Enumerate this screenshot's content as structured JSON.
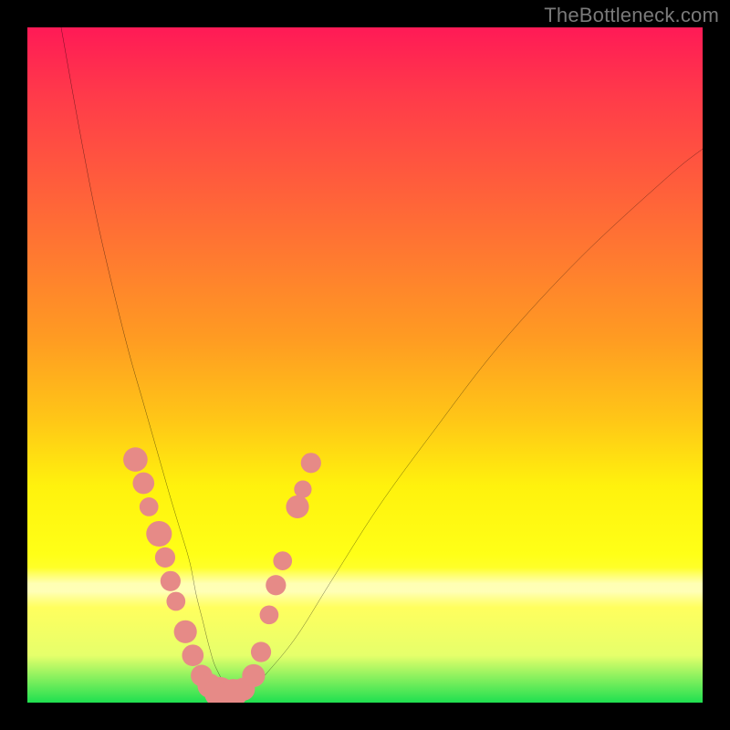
{
  "watermark": "TheBottleneck.com",
  "chart_data": {
    "type": "line",
    "title": "",
    "xlabel": "",
    "ylabel": "",
    "x_range": [
      0,
      100
    ],
    "y_range": [
      0,
      100
    ],
    "note": "No numeric axis ticks are visible; values are estimated in 0–100 plot-area percent coordinates (y = 0 at top, 100 at bottom).",
    "series": [
      {
        "name": "curve",
        "x": [
          5,
          7.5,
          10,
          12.5,
          15,
          17,
          19,
          21,
          22.5,
          24,
          25,
          26,
          27,
          28,
          30,
          33,
          36,
          40,
          45,
          52,
          60,
          70,
          82,
          95,
          100
        ],
        "y": [
          0,
          14,
          27,
          38,
          48,
          55,
          62,
          69,
          74,
          79,
          84,
          88,
          92,
          95,
          98,
          98,
          95,
          90,
          82,
          71,
          60,
          47,
          34,
          22,
          18
        ]
      }
    ],
    "markers": [
      {
        "x": 16.0,
        "y": 64.0,
        "r": 1.8
      },
      {
        "x": 17.2,
        "y": 67.5,
        "r": 1.6
      },
      {
        "x": 18.0,
        "y": 71.0,
        "r": 1.4
      },
      {
        "x": 19.5,
        "y": 75.0,
        "r": 1.9
      },
      {
        "x": 20.4,
        "y": 78.5,
        "r": 1.5
      },
      {
        "x": 21.2,
        "y": 82.0,
        "r": 1.5
      },
      {
        "x": 22.0,
        "y": 85.0,
        "r": 1.4
      },
      {
        "x": 23.4,
        "y": 89.5,
        "r": 1.7
      },
      {
        "x": 24.5,
        "y": 93.0,
        "r": 1.6
      },
      {
        "x": 25.8,
        "y": 96.0,
        "r": 1.6
      },
      {
        "x": 27.0,
        "y": 97.5,
        "r": 1.8
      },
      {
        "x": 28.5,
        "y": 98.5,
        "r": 2.3
      },
      {
        "x": 30.5,
        "y": 98.6,
        "r": 2.1
      },
      {
        "x": 32.0,
        "y": 98.0,
        "r": 1.7
      },
      {
        "x": 33.5,
        "y": 96.0,
        "r": 1.7
      },
      {
        "x": 34.6,
        "y": 92.5,
        "r": 1.5
      },
      {
        "x": 35.8,
        "y": 87.0,
        "r": 1.4
      },
      {
        "x": 36.8,
        "y": 82.6,
        "r": 1.5
      },
      {
        "x": 37.8,
        "y": 79.0,
        "r": 1.4
      },
      {
        "x": 40.0,
        "y": 71.0,
        "r": 1.7
      },
      {
        "x": 40.8,
        "y": 68.4,
        "r": 1.3
      },
      {
        "x": 42.0,
        "y": 64.5,
        "r": 1.5
      }
    ],
    "gradient_stops": [
      {
        "pos": 0,
        "color": "#ff1a56"
      },
      {
        "pos": 10,
        "color": "#ff3a4a"
      },
      {
        "pos": 22,
        "color": "#ff5a3d"
      },
      {
        "pos": 34,
        "color": "#ff7a30"
      },
      {
        "pos": 46,
        "color": "#ff9b22"
      },
      {
        "pos": 58,
        "color": "#ffc617"
      },
      {
        "pos": 68,
        "color": "#fff20d"
      },
      {
        "pos": 78,
        "color": "#ffff17"
      },
      {
        "pos": 86,
        "color": "#ffff5e"
      },
      {
        "pos": 93,
        "color": "#e6ff6b"
      },
      {
        "pos": 100,
        "color": "#1fe050"
      }
    ],
    "pale_band": {
      "top_pct": 80,
      "height_pct": 6
    }
  }
}
